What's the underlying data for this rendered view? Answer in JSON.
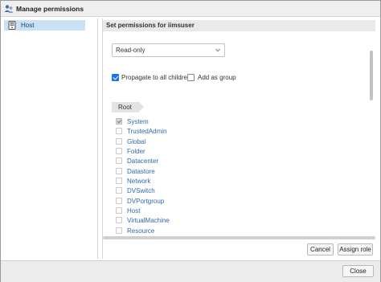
{
  "window": {
    "title": "Manage permissions",
    "icon": "users-permissions-icon"
  },
  "tree": {
    "items": [
      {
        "label": "Host",
        "icon": "host-icon",
        "selected": true
      }
    ]
  },
  "panel": {
    "header": "Set permissions for iimsuser",
    "role_select": {
      "value": "Read-only"
    },
    "propagate": {
      "label": "Propagate to all children",
      "checked": true
    },
    "add_as_group": {
      "label": "Add as group",
      "checked": false
    },
    "breadcrumb": "Root",
    "objects": [
      {
        "label": "System",
        "checked": true,
        "disabled": true
      },
      {
        "label": "TrustedAdmin",
        "checked": false
      },
      {
        "label": "Global",
        "checked": false
      },
      {
        "label": "Folder",
        "checked": false
      },
      {
        "label": "Datacenter",
        "checked": false
      },
      {
        "label": "Datastore",
        "checked": false
      },
      {
        "label": "Network",
        "checked": false
      },
      {
        "label": "DVSwitch",
        "checked": false
      },
      {
        "label": "DVPortgroup",
        "checked": false
      },
      {
        "label": "Host",
        "checked": false
      },
      {
        "label": "VirtualMachine",
        "checked": false
      },
      {
        "label": "Resource",
        "checked": false
      }
    ],
    "buttons": {
      "cancel": "Cancel",
      "assign_role": "Assign role"
    }
  },
  "footer": {
    "close": "Close"
  },
  "colors": {
    "accent": "#1a73e8",
    "selection": "#c8e1f5",
    "link_text": "#2f6aa8"
  }
}
